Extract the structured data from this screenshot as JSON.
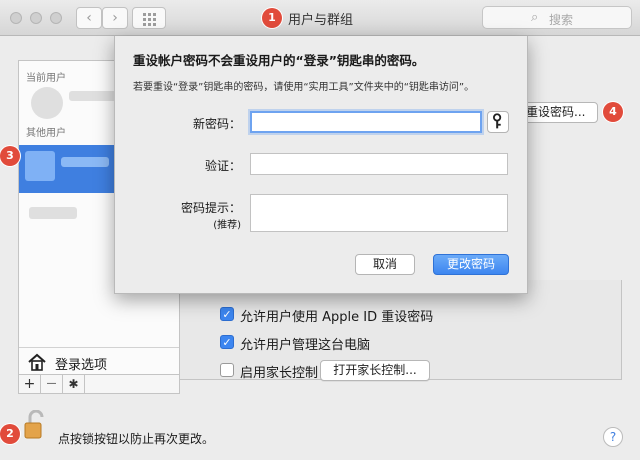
{
  "window": {
    "title": "用户与群组",
    "search_placeholder": "搜索",
    "nav_back": "‹",
    "nav_forward": "›"
  },
  "badges": [
    "1",
    "2",
    "3",
    "4"
  ],
  "sidebar": {
    "current_user_label": "当前用户",
    "other_users_label": "其他用户",
    "login_options": "登录选项",
    "add": "+",
    "remove": "—",
    "gear": "✱"
  },
  "main": {
    "reset_password_button": "重设密码...",
    "check_apple_id": "允许用户使用 Apple ID 重设密码",
    "check_admin": "允许用户管理这台电脑",
    "check_parental": "启用家长控制",
    "parental_button": "打开家长控制...",
    "apple_id_checked": true,
    "admin_checked": true,
    "parental_checked": false
  },
  "sheet": {
    "title": "重设帐户密码不会重设用户的“登录”钥匙串的密码。",
    "subtitle": "若要重设“登录”钥匙串的密码，请使用“实用工具”文件夹中的“钥匙串访问”。",
    "new_password_label": "新密码：",
    "verify_label": "验证：",
    "hint_label": "密码提示：",
    "hint_sub": "(推荐)",
    "cancel_button": "取消",
    "change_button": "更改密码"
  },
  "footer": {
    "lock_text": "点按锁按钮以防止再次更改。",
    "help": "?"
  },
  "colors": {
    "accent": "#3d86f0",
    "badge": "#e14b3b",
    "selection": "#3f7fe0"
  }
}
